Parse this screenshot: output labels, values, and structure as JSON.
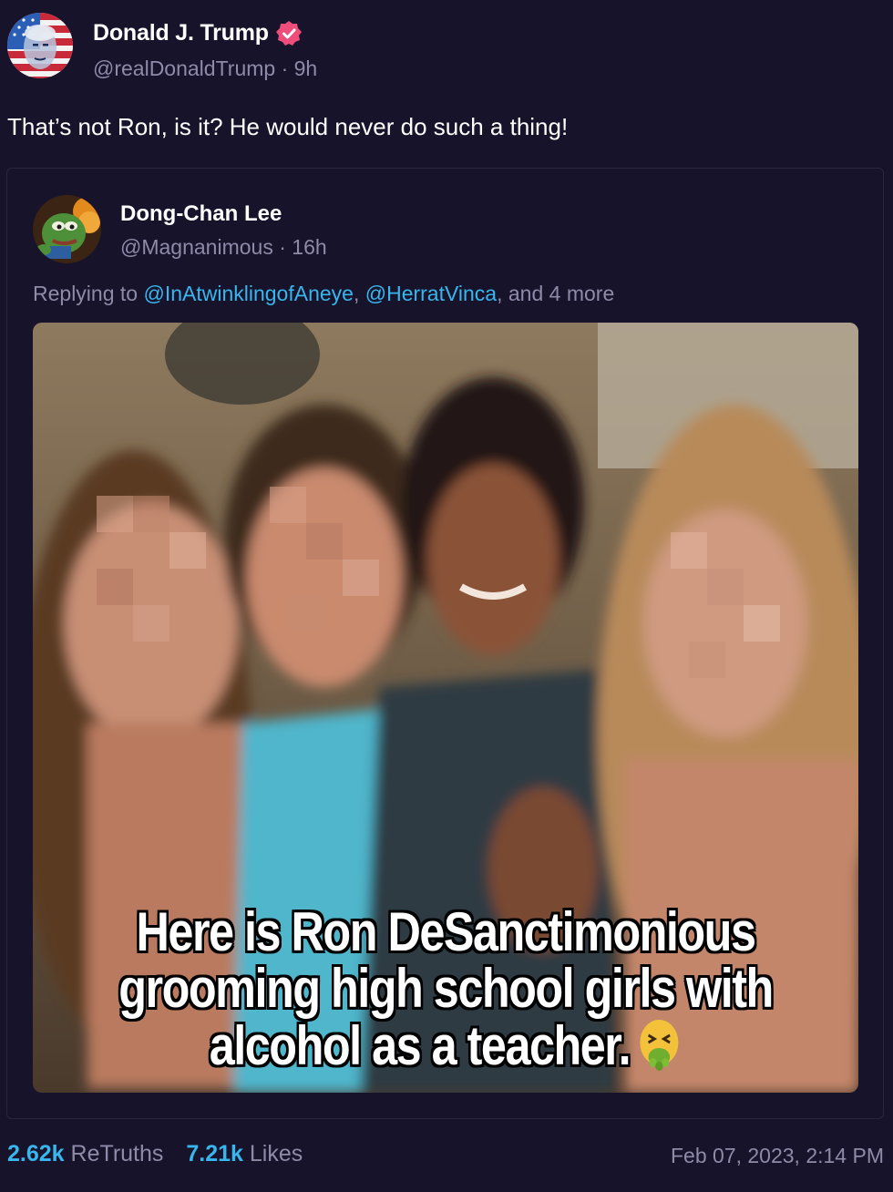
{
  "post": {
    "author_name": "Donald J. Trump",
    "author_handle": "@realDonaldTrump",
    "time_ago": "9h",
    "separator": " · ",
    "text": "That’s not Ron, is it? He would never do such a thing!",
    "avatar_icon": "flag-portrait-avatar",
    "verified_icon": "verified-badge-icon",
    "verified_color": "#ef4e7a"
  },
  "quote": {
    "author_name": "Dong-Chan Lee",
    "author_handle": "@Magnanimous",
    "time_ago": "16h",
    "separator": " · ",
    "replying_prefix": "Replying to ",
    "mentions": [
      "@InAtwinklingofAneye",
      "@HerratVinca"
    ],
    "mention_separator": ", ",
    "replying_suffix": ", and 4 more",
    "media_caption_lines": [
      "Here is Ron DeSanctimonious",
      "grooming high school girls with",
      "alcohol as a teacher."
    ],
    "caption_emoji": "nauseated-face-icon"
  },
  "stats": {
    "retruths_count": "2.62k",
    "retruths_label": "ReTruths",
    "likes_count": "7.21k",
    "likes_label": "Likes"
  },
  "timestamp": "Feb 07, 2023, 2:14 PM",
  "colors": {
    "background": "#16132a",
    "accent": "#39b6ee",
    "muted": "#8f8aa8",
    "verified": "#ef4e7a"
  }
}
